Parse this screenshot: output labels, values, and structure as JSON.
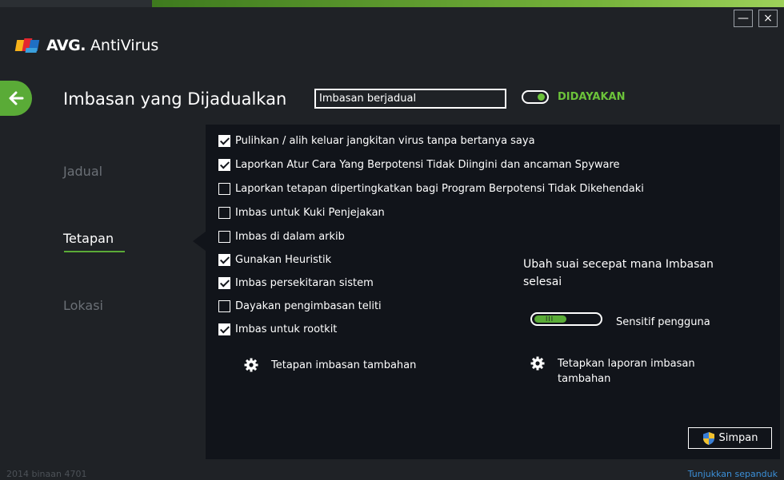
{
  "window": {
    "minimize_glyph": "—",
    "close_glyph": "×"
  },
  "logo": {
    "brand": "AVG.",
    "product": "AntiVirus"
  },
  "header": {
    "title": "Imbasan yang Dijadualkan",
    "name_value": "Imbasan berjadual",
    "toggle_label": "DIDAYAKAN"
  },
  "nav": {
    "items": [
      {
        "label": "Jadual",
        "active": false
      },
      {
        "label": "Tetapan",
        "active": true
      },
      {
        "label": "Lokasi",
        "active": false
      }
    ]
  },
  "settings": {
    "checkboxes": [
      {
        "label": "Pulihkan / alih keluar jangkitan virus tanpa bertanya saya",
        "checked": true
      },
      {
        "label": "Laporkan Atur Cara Yang Berpotensi Tidak Diingini dan ancaman Spyware",
        "checked": true
      },
      {
        "label": "Laporkan tetapan dipertingkatkan bagi Program Berpotensi Tidak Dikehendaki",
        "checked": false
      },
      {
        "label": "Imbas untuk Kuki Penjejakan",
        "checked": false
      },
      {
        "label": "Imbas di dalam arkib",
        "checked": false
      },
      {
        "label": "Gunakan Heuristik",
        "checked": true
      },
      {
        "label": "Imbas persekitaran sistem",
        "checked": true
      },
      {
        "label": "Dayakan pengimbasan teliti",
        "checked": false
      },
      {
        "label": "Imbas untuk rootkit",
        "checked": true
      }
    ],
    "speed_title": "Ubah suai secepat mana Imbasan selesai",
    "slider_label": "Sensitif pengguna",
    "slider_level": 0.5,
    "slider_grip": "III",
    "additional_scan_settings": "Tetapan imbasan tambahan",
    "additional_reports": "Tetapkan laporan imbasan tambahan",
    "save_label": "Simpan"
  },
  "footer": {
    "build": "2014  binaan 4701",
    "show_notification": "Tunjukkan sepanduk"
  },
  "colors": {
    "accent_green": "#5aab37",
    "background": "#1f2226",
    "panel": "#11141a",
    "link_blue": "#3b8fd8"
  }
}
